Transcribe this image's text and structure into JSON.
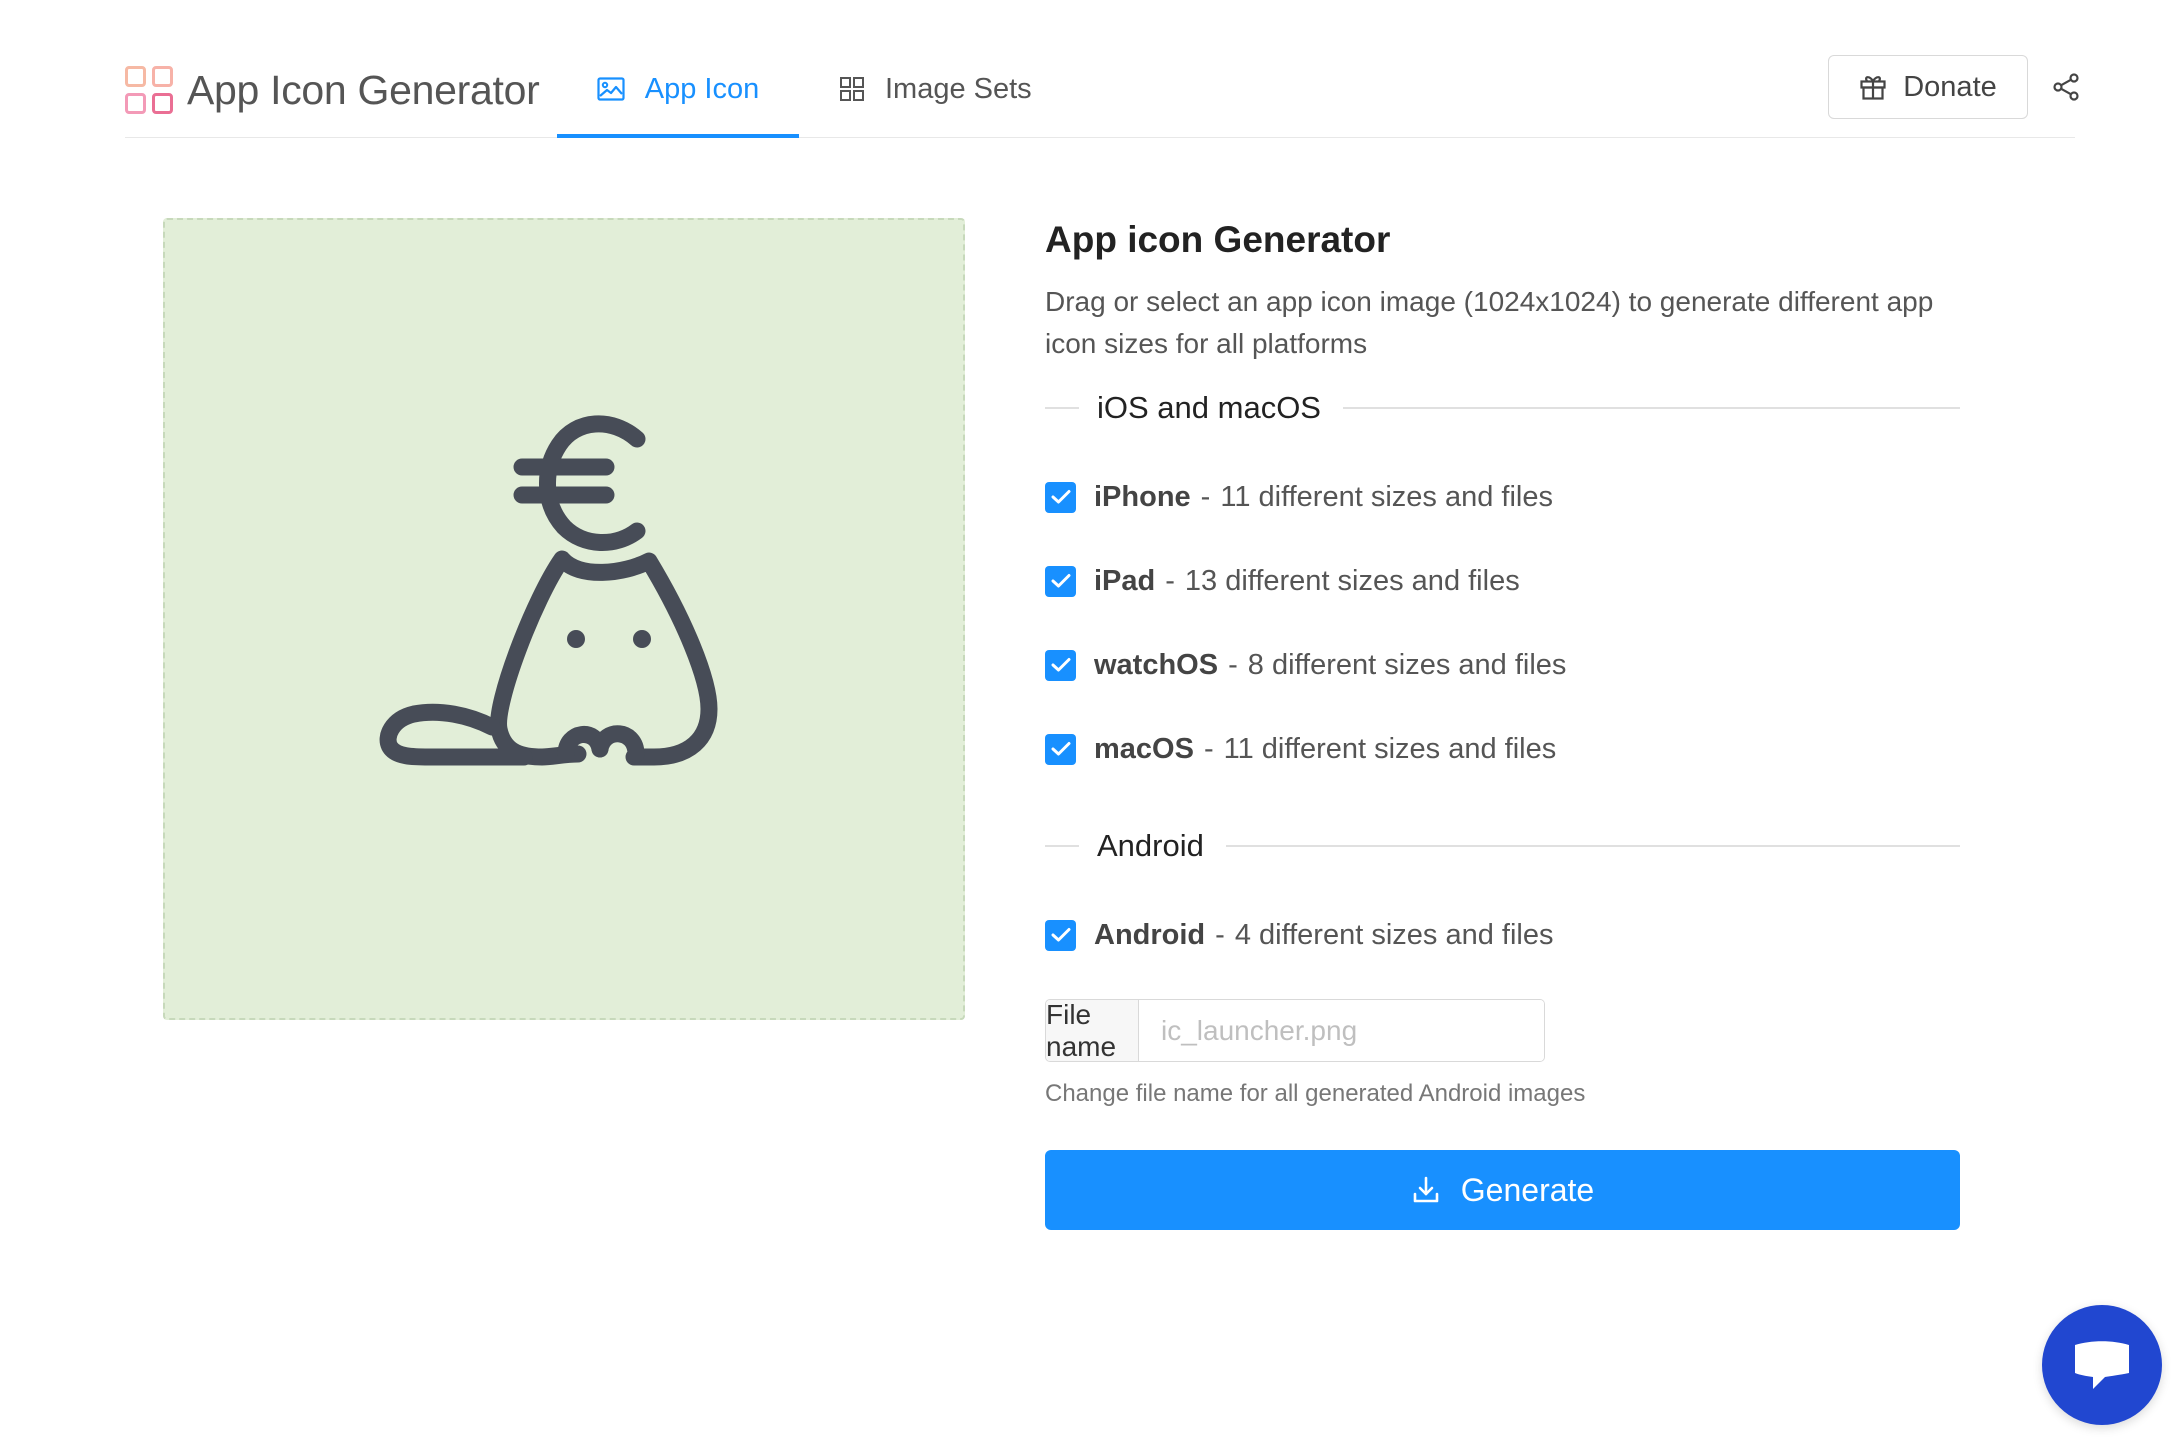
{
  "app": {
    "name": "App Icon Generator",
    "logo_colors": [
      "#f6b9a4",
      "#f6a1a8",
      "#f39ab7",
      "#ea5f8d"
    ]
  },
  "nav": {
    "tabs": [
      {
        "label": "App Icon",
        "icon": "image-icon",
        "active": true
      },
      {
        "label": "Image Sets",
        "icon": "grid-icon",
        "active": false
      }
    ],
    "donate_label": "Donate",
    "donate_icon": "gift-icon",
    "share_icon": "share-icon"
  },
  "dropzone": {
    "preview_icon": "cat-with-euro-icon",
    "background": "#e2eed8"
  },
  "panel": {
    "title": "App icon Generator",
    "description": "Drag or select an app icon image (1024x1024) to generate different app icon sizes for all platforms",
    "sections": [
      {
        "heading": "iOS and macOS",
        "options": [
          {
            "name": "iPhone",
            "detail": "11 different sizes and files",
            "checked": true
          },
          {
            "name": "iPad",
            "detail": "13 different sizes and files",
            "checked": true
          },
          {
            "name": "watchOS",
            "detail": "8 different sizes and files",
            "checked": true
          },
          {
            "name": "macOS",
            "detail": "11 different sizes and files",
            "checked": true
          }
        ]
      },
      {
        "heading": "Android",
        "options": [
          {
            "name": "Android",
            "detail": "4 different sizes and files",
            "checked": true
          }
        ]
      }
    ],
    "separator": "-",
    "file_name": {
      "label": "File name",
      "value": "",
      "placeholder": "ic_launcher.png",
      "help": "Change file name for all generated Android images"
    },
    "generate_label": "Generate",
    "generate_icon": "download-icon"
  },
  "chat": {
    "icon": "chat-bubble-icon"
  },
  "colors": {
    "accent": "#1890ff",
    "chat": "#2147d0",
    "icon_stroke": "#474c57"
  }
}
